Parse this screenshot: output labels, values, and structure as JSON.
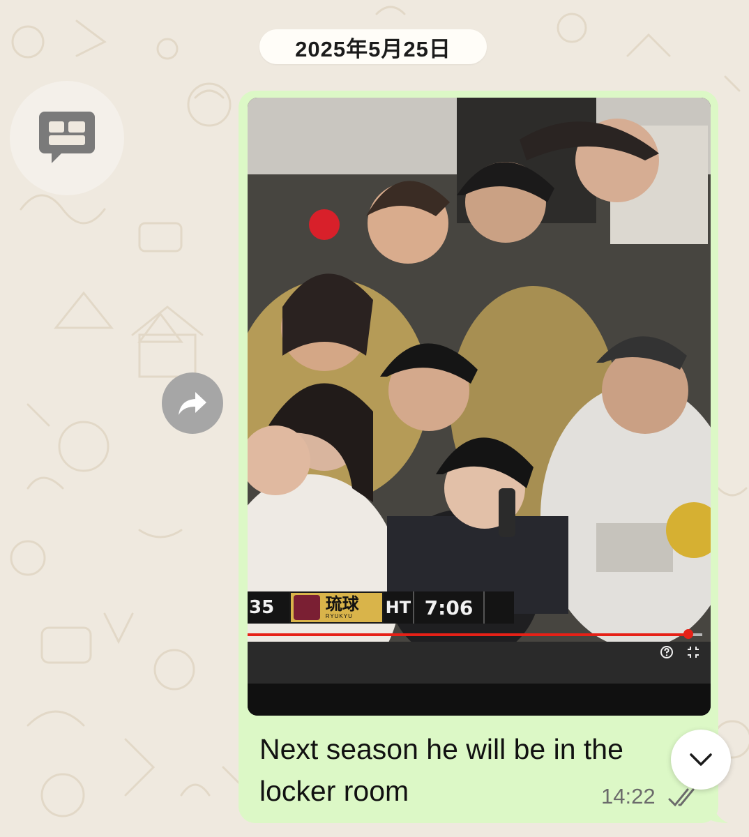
{
  "chat": {
    "date_separator": "2025年5月25日"
  },
  "message": {
    "caption": "Next season he will be in the locker room",
    "time": "14:22",
    "status": "read",
    "bubble_color": "#dcf8c6"
  },
  "video": {
    "scoreboard": {
      "left_score": "35",
      "team_name": "琉球",
      "team_subtitle": "RYUKYU",
      "period": "HT",
      "clock": "7:06"
    },
    "progress_fraction": 0.97,
    "progress_color": "#e62117"
  },
  "icons": {
    "summary": "chat-summary-icon",
    "forward": "forward-icon",
    "scroll_down": "chevron-down-icon",
    "read_receipt": "double-check-icon"
  }
}
